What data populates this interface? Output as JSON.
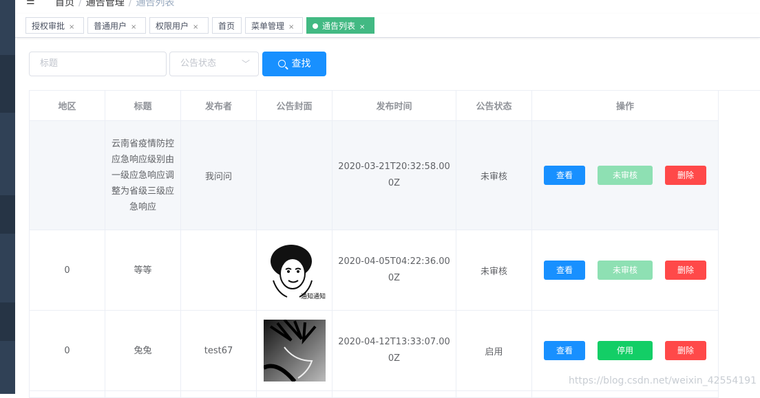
{
  "header": {
    "breadcrumb": [
      "首页",
      "通告管理",
      "通告列表"
    ]
  },
  "tags": [
    {
      "label": "授权审批",
      "active": false
    },
    {
      "label": "普通用户",
      "active": false
    },
    {
      "label": "权限用户",
      "active": false
    },
    {
      "label": "首页",
      "active": false
    },
    {
      "label": "菜单管理",
      "active": false
    },
    {
      "label": "通告列表",
      "active": true
    }
  ],
  "filter": {
    "title_placeholder": "标题",
    "status_placeholder": "公告状态",
    "search_label": "查找"
  },
  "table": {
    "columns": [
      "地区",
      "标题",
      "发布者",
      "公告封面",
      "发布时间",
      "公告状态",
      "操作"
    ],
    "rows": [
      {
        "region": "",
        "title": "云南省疫情防控应急响应级别由一级应急响应调整为省级三级应急响应",
        "publisher": "我问问",
        "cover": "none",
        "time": "2020-03-21T20:32:58.000Z",
        "status": "未审核",
        "view_label": "查看",
        "toggle_label": "未审核",
        "toggle_kind": "pending",
        "delete_label": "删除"
      },
      {
        "region": "0",
        "title": "等等",
        "publisher": "",
        "cover": "meme-face-icon",
        "cover_caption": "通知通知",
        "time": "2020-04-05T04:22:36.000Z",
        "status": "未审核",
        "view_label": "查看",
        "toggle_label": "未审核",
        "toggle_kind": "pending",
        "delete_label": "删除"
      },
      {
        "region": "0",
        "title": "兔兔",
        "publisher": "test67",
        "cover": "anime-sketch-icon",
        "time": "2020-04-12T13:33:07.000Z",
        "status": "启用",
        "view_label": "查看",
        "toggle_label": "停用",
        "toggle_kind": "disable",
        "delete_label": "删除"
      }
    ]
  },
  "watermark": "https://blog.csdn.net/weixin_42554191"
}
